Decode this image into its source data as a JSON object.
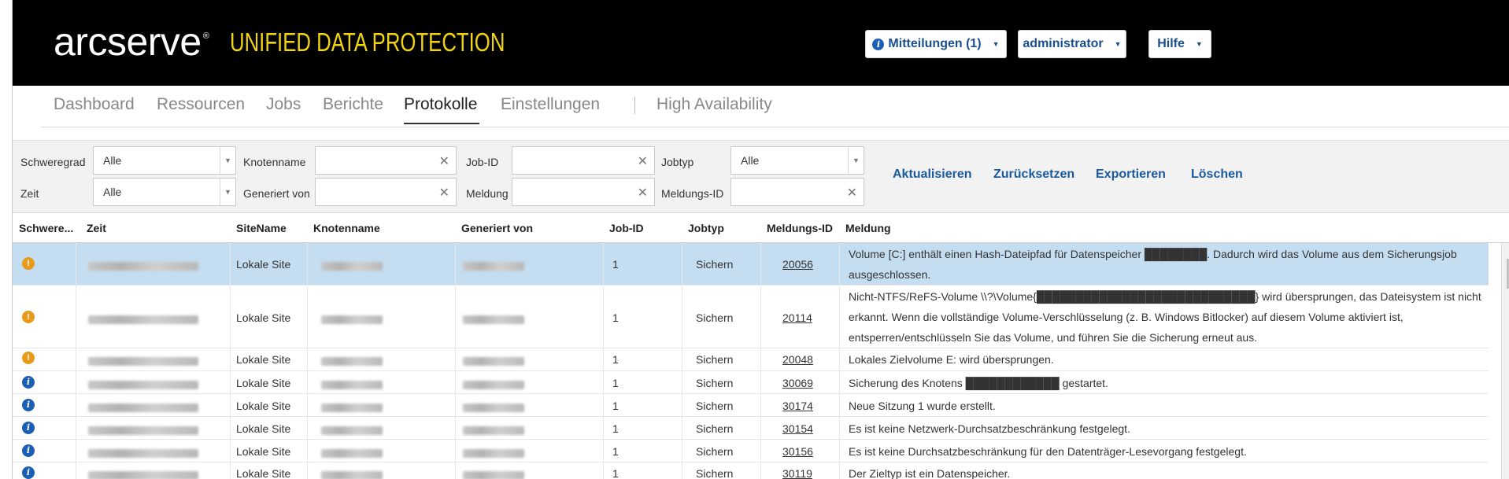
{
  "header": {
    "logo_text": "arcserve",
    "logo_reg": "®",
    "tagline": "UNIFIED DATA PROTECTION",
    "notifications_label": "Mitteilungen (1)",
    "user_label": "administrator",
    "help_label": "Hilfe",
    "caret": "▼",
    "info_glyph": "i"
  },
  "nav": {
    "tabs": [
      {
        "label": "Dashboard"
      },
      {
        "label": "Ressourcen"
      },
      {
        "label": "Jobs"
      },
      {
        "label": "Berichte"
      },
      {
        "label": "Protokolle"
      },
      {
        "label": "Einstellungen"
      },
      {
        "label": "High Availability"
      }
    ],
    "active": "Protokolle"
  },
  "filters": {
    "severity_label": "Schweregrad",
    "severity_value": "Alle",
    "time_label": "Zeit",
    "time_value": "Alle",
    "node_label": "Knotenname",
    "node_value": "",
    "generated_label": "Generiert von",
    "generated_value": "",
    "jobid_label": "Job-ID",
    "jobid_value": "",
    "message_label": "Meldung",
    "message_value": "",
    "jobtype_label": "Jobtyp",
    "jobtype_value": "Alle",
    "msgid_label": "Meldungs-ID",
    "msgid_value": "",
    "clear_glyph": "✕",
    "dd_glyph": "▼",
    "actions": {
      "refresh": "Aktualisieren",
      "reset": "Zurücksetzen",
      "export": "Exportieren",
      "delete": "Löschen"
    }
  },
  "table": {
    "columns": [
      "Schwere...",
      "Zeit",
      "SiteName",
      "Knotenname",
      "Generiert von",
      "Job-ID",
      "Jobtyp",
      "Meldungs-ID",
      "Meldung"
    ],
    "rows": [
      {
        "severity": "warning",
        "site": "Lokale Site",
        "job_id": "1",
        "job_type": "Sichern",
        "msg_id": "20056",
        "message": "Volume [C:] enthält einen Hash-Dateipfad für Datenspeicher ████████. Dadurch wird das Volume aus dem Sicherungsjob ausgeschlossen."
      },
      {
        "severity": "warning",
        "site": "Lokale Site",
        "job_id": "1",
        "job_type": "Sichern",
        "msg_id": "20114",
        "message": "Nicht-NTFS/ReFS-Volume \\\\?\\Volume{████████████████████████████} wird übersprungen, das Dateisystem ist nicht erkannt. Wenn die vollständige Volume-Verschlüsselung (z. B. Windows Bitlocker) auf diesem Volume aktiviert ist, entsperren/entschlüsseln Sie das Volume, und führen Sie die Sicherung erneut aus."
      },
      {
        "severity": "warning",
        "site": "Lokale Site",
        "job_id": "1",
        "job_type": "Sichern",
        "msg_id": "20048",
        "message": "Lokales Zielvolume E: wird übersprungen."
      },
      {
        "severity": "info",
        "site": "Lokale Site",
        "job_id": "1",
        "job_type": "Sichern",
        "msg_id": "30069",
        "message": "Sicherung des Knotens ████████████ gestartet."
      },
      {
        "severity": "info",
        "site": "Lokale Site",
        "job_id": "1",
        "job_type": "Sichern",
        "msg_id": "30174",
        "message": "Neue Sitzung 1 wurde erstellt."
      },
      {
        "severity": "info",
        "site": "Lokale Site",
        "job_id": "1",
        "job_type": "Sichern",
        "msg_id": "30154",
        "message": "Es ist keine Netzwerk-Durchsatzbeschränkung festgelegt."
      },
      {
        "severity": "info",
        "site": "Lokale Site",
        "job_id": "1",
        "job_type": "Sichern",
        "msg_id": "30156",
        "message": "Es ist keine Durchsatzbeschränkung für den Datenträger-Lesevorgang festgelegt."
      },
      {
        "severity": "info",
        "site": "Lokale Site",
        "job_id": "1",
        "job_type": "Sichern",
        "msg_id": "30119",
        "message": "Der Zieltyp ist ein Datenspeicher."
      }
    ]
  },
  "scrollbar": {
    "up_glyph": "▲"
  }
}
